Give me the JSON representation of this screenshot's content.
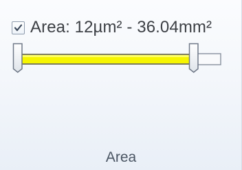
{
  "filter": {
    "checked": true,
    "label": "Area: 12µm² - 36.04mm²"
  },
  "slider": {
    "track_color": "#f6f500",
    "range_low": "12µm²",
    "range_high": "36.04mm²"
  },
  "group": {
    "caption": "Area"
  }
}
